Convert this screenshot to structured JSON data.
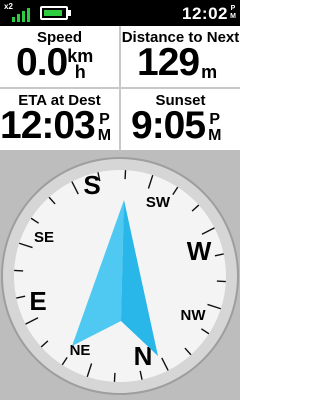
{
  "status_bar": {
    "satellites": "x2",
    "signal_icon": "signal-bars-icon",
    "battery_icon": "battery-icon",
    "battery_level": 0.9,
    "time": "12:02",
    "time_suffix_top": "P",
    "time_suffix_bottom": "M",
    "accent_color": "#2ecc40"
  },
  "fields": {
    "speed": {
      "label": "Speed",
      "value": "0.0",
      "unit_top": "km",
      "unit_bottom": "h"
    },
    "distance_to_next": {
      "label": "Distance to Next",
      "value": "129",
      "unit": "m"
    },
    "eta_at_dest": {
      "label": "ETA at Dest",
      "value": "12:03",
      "suffix_top": "P",
      "suffix_bottom": "M"
    },
    "sunset": {
      "label": "Sunset",
      "value": "9:05",
      "suffix_top": "P",
      "suffix_bottom": "M"
    }
  },
  "compass": {
    "labels": {
      "s": "S",
      "sw": "SW",
      "w": "W",
      "nw": "NW",
      "n": "N",
      "ne": "NE",
      "e": "E",
      "se": "SE"
    },
    "bearing_pointer_color": "#29b6e8",
    "bearing_pointer_icon": "bearing-pointer-icon"
  }
}
